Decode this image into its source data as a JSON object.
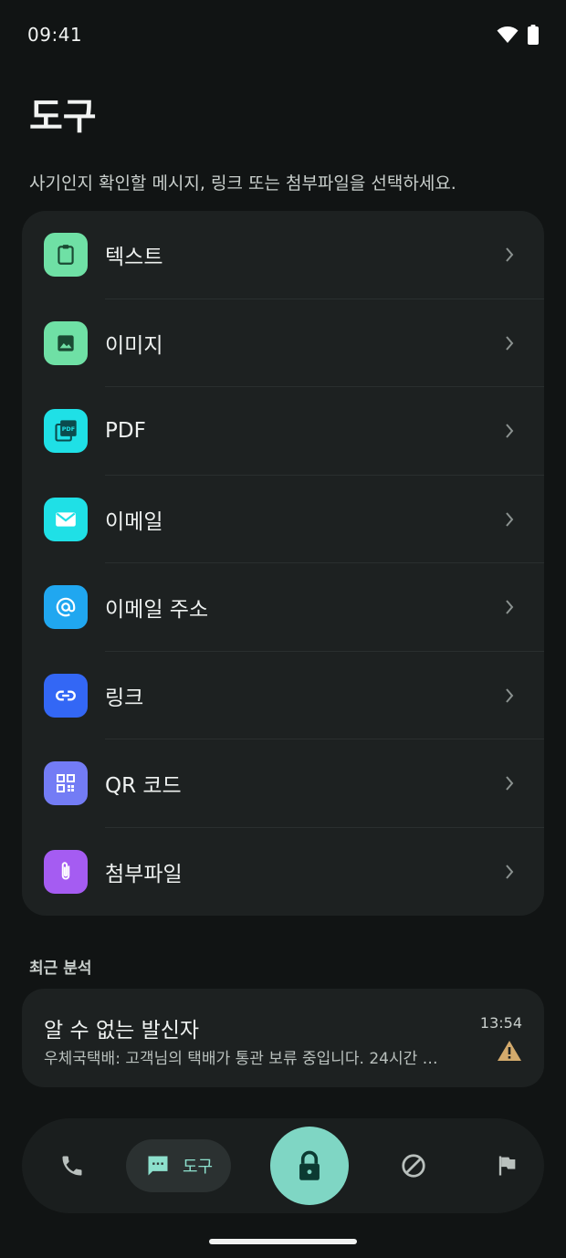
{
  "status": {
    "time": "09:41"
  },
  "header": {
    "title": "도구",
    "subtitle": "사기인지 확인할 메시지, 링크 또는 첨부파일을 선택하세요."
  },
  "tools": [
    {
      "label": "텍스트",
      "icon": "clipboard-icon",
      "color": "#6fe0a5"
    },
    {
      "label": "이미지",
      "icon": "image-icon",
      "color": "#6fe0a5"
    },
    {
      "label": "PDF",
      "icon": "pdf-icon",
      "color": "#1fe0e6"
    },
    {
      "label": "이메일",
      "icon": "mail-icon",
      "color": "#1fe0e6"
    },
    {
      "label": "이메일 주소",
      "icon": "at-sign-icon",
      "color": "#20a7f0"
    },
    {
      "label": "링크",
      "icon": "link-icon",
      "color": "#3367f5"
    },
    {
      "label": "QR 코드",
      "icon": "qr-code-icon",
      "color": "#737cf5"
    },
    {
      "label": "첨부파일",
      "icon": "paperclip-icon",
      "color": "#a55cf2"
    }
  ],
  "recent": {
    "section_title": "최근 분석",
    "sender": "알 수 없는 발신자",
    "snippet": "우체국택배: 고객님의 택배가 통관 보류 중입니다. 24시간 …",
    "time": "13:54",
    "warning_color": "#d3aa6c"
  },
  "nav": {
    "active_label": "도구",
    "accent": "#7fd6c4"
  }
}
